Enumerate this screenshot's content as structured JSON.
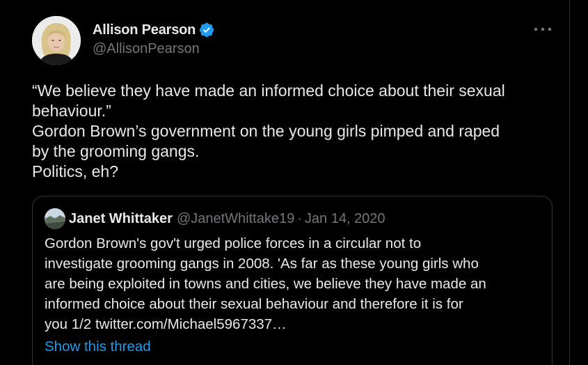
{
  "tweet": {
    "author_name": "Allison Pearson",
    "author_handle": "@AllisonPearson",
    "avatar_icon": "user-avatar-photo",
    "verified_icon": "verified-badge-icon",
    "more_icon": "more-options-icon",
    "text_lines": [
      "“We believe they have made an informed choice about their sexual",
      "behaviour.”",
      "Gordon Brown’s government on the young girls pimped and raped",
      "by the grooming gangs.",
      "Politics, eh?"
    ]
  },
  "quote": {
    "author_name": "Janet Whittaker",
    "author_handle": "@JanetWhittake19",
    "separator": "·",
    "date": "Jan 14, 2020",
    "text_lines": [
      "Gordon Brown's gov't urged police forces in a circular not to",
      "investigate grooming gangs in 2008.  'As far as these young girls who",
      "are being exploited in towns and cities, we believe they have made an",
      "informed choice about their sexual behaviour  and therefore it is for",
      "you 1/2 twitter.com/Michael5967337…"
    ],
    "show_thread_label": "Show this thread"
  },
  "colors": {
    "background": "#000000",
    "text_primary": "#e7e9ea",
    "text_secondary": "#71767b",
    "accent": "#1d9bf0",
    "border": "#2f3336"
  }
}
